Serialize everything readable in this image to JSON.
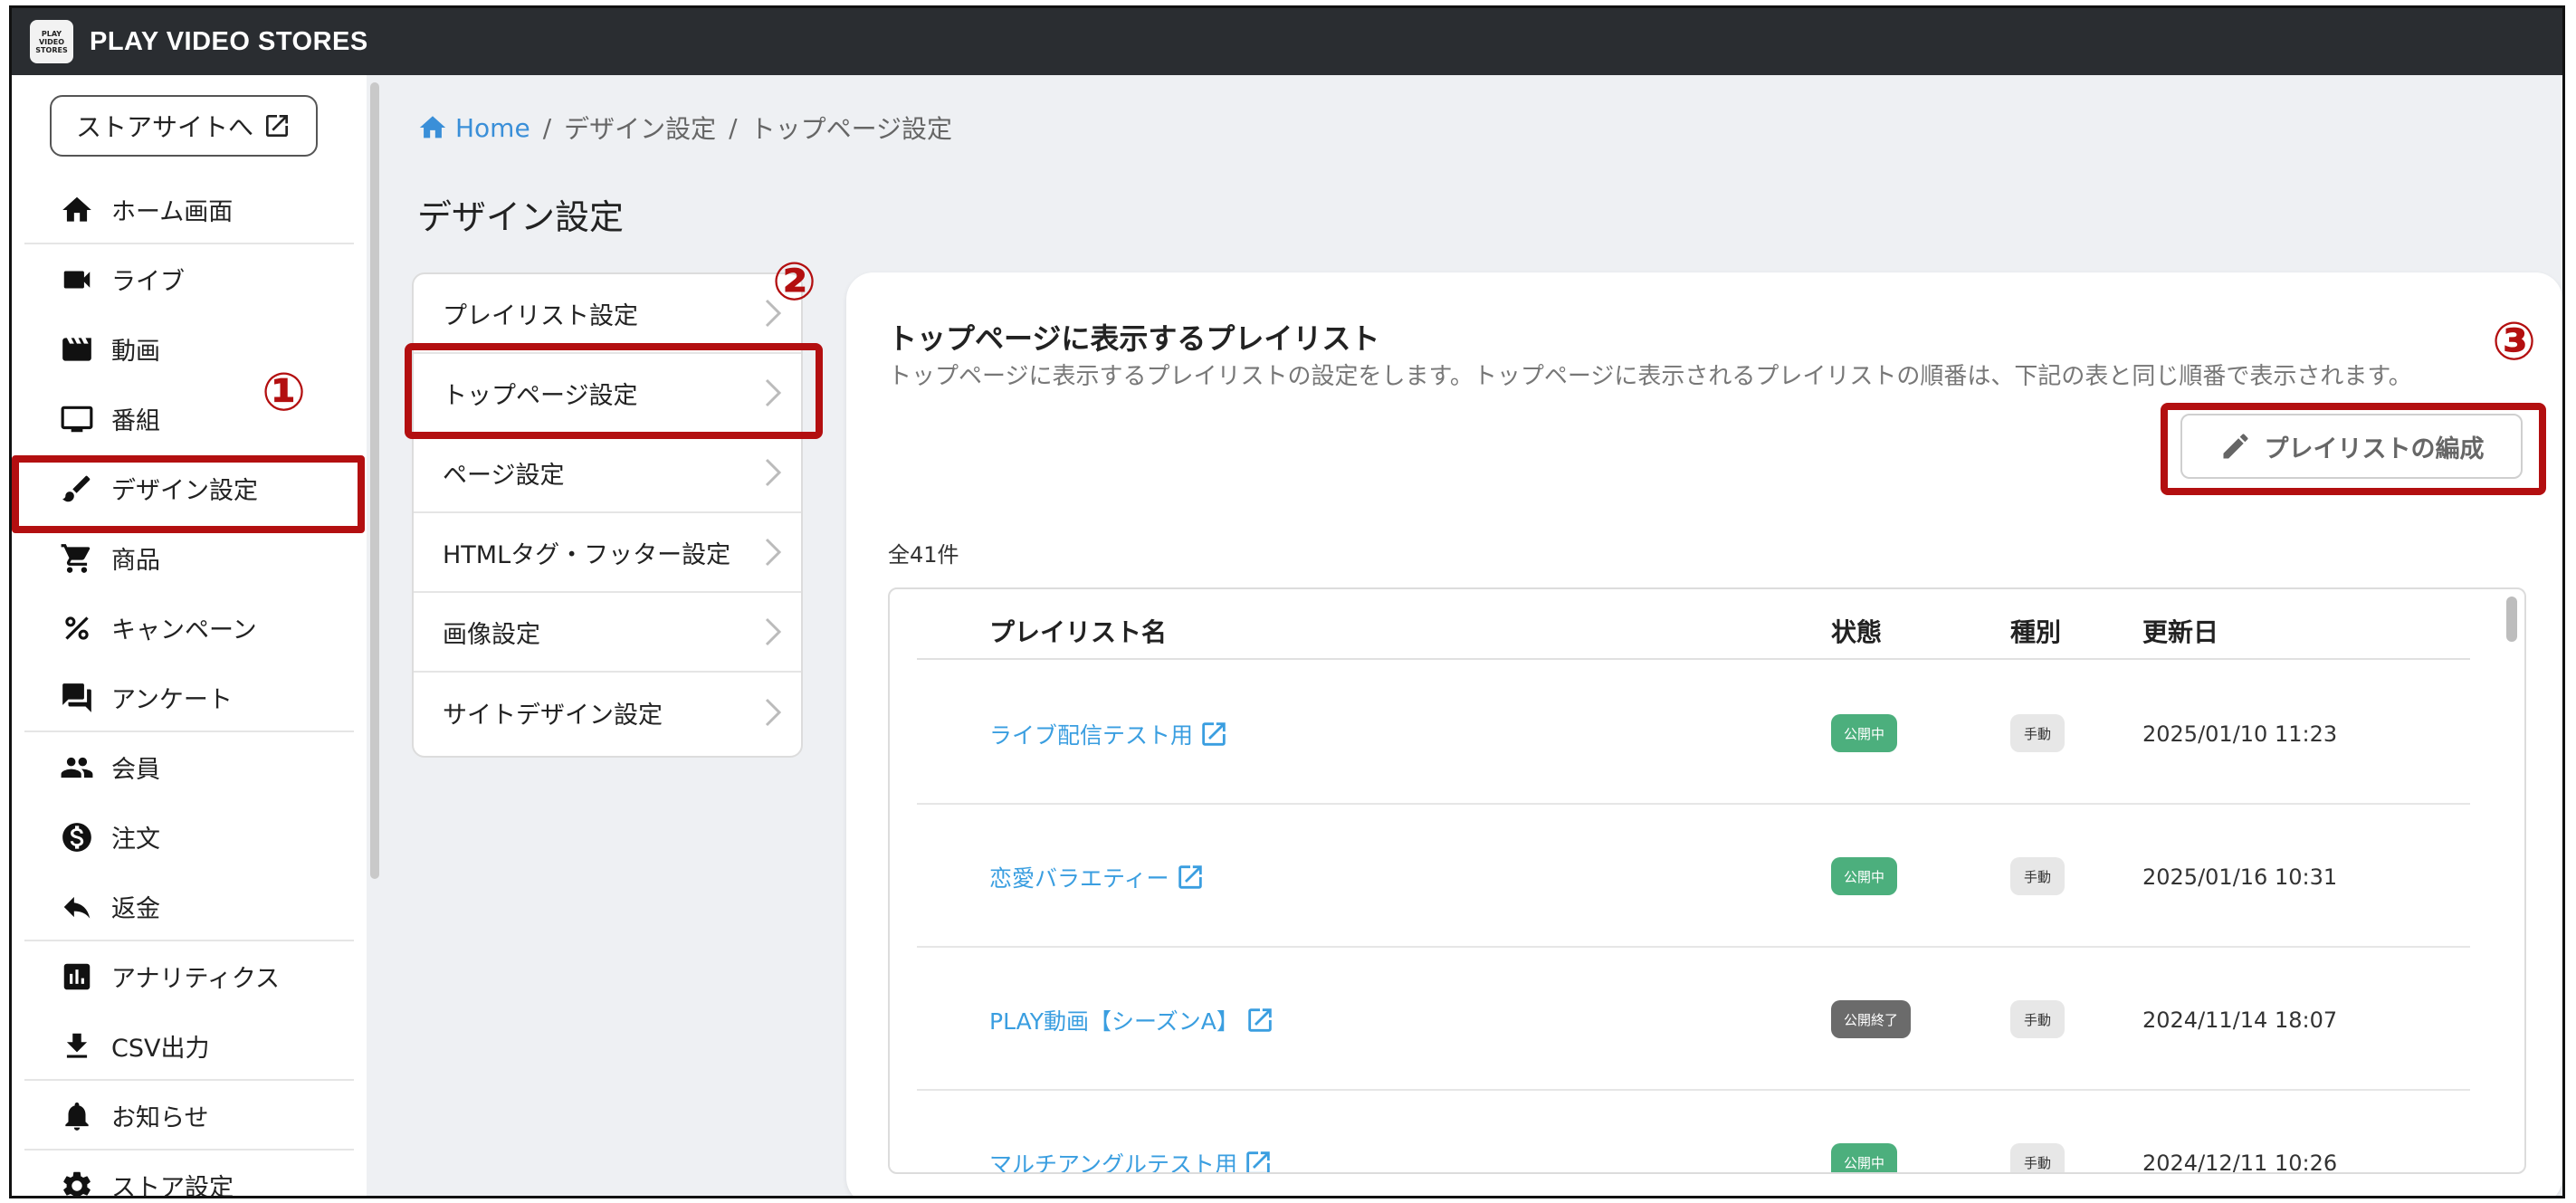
{
  "app": {
    "brand": "PLAY VIDEO STORES",
    "logo_text": [
      "PLAY",
      "VIDEO",
      "STORES"
    ]
  },
  "sidebar": {
    "store_button": "ストアサイトへ",
    "items": [
      {
        "label": "ホーム画面",
        "icon": "home-icon"
      },
      {
        "label": "ライブ",
        "icon": "videocam-icon"
      },
      {
        "label": "動画",
        "icon": "movie-icon"
      },
      {
        "label": "番組",
        "icon": "tv-icon"
      },
      {
        "label": "デザイン設定",
        "icon": "brush-icon"
      },
      {
        "label": "商品",
        "icon": "cart-icon"
      },
      {
        "label": "キャンペーン",
        "icon": "percent-icon"
      },
      {
        "label": "アンケート",
        "icon": "forum-icon"
      },
      {
        "label": "会員",
        "icon": "people-icon"
      },
      {
        "label": "注文",
        "icon": "dollar-icon"
      },
      {
        "label": "返金",
        "icon": "reply-icon"
      },
      {
        "label": "アナリティクス",
        "icon": "analytics-icon"
      },
      {
        "label": "CSV出力",
        "icon": "download-icon"
      },
      {
        "label": "お知らせ",
        "icon": "bell-icon"
      },
      {
        "label": "ストア設定",
        "icon": "gear-icon"
      }
    ]
  },
  "annotations": {
    "n1": "①",
    "n2": "②",
    "n3": "③"
  },
  "breadcrumb": {
    "home": "Home",
    "sep": "/",
    "level1": "デザイン設定",
    "level2": "トップページ設定"
  },
  "page_title": "デザイン設定",
  "submenu": [
    "プレイリスト設定",
    "トップページ設定",
    "ページ設定",
    "HTMLタグ・フッター設定",
    "画像設定",
    "サイトデザイン設定"
  ],
  "card": {
    "title": "トップページに表示するプレイリスト",
    "description": "トップページに表示するプレイリストの設定をします。トップページに表示されるプレイリストの順番は、下記の表と同じ順番で表示されます。",
    "edit_button": "プレイリストの編成",
    "total": "全41件"
  },
  "table": {
    "headers": {
      "name": "プレイリスト名",
      "status": "状態",
      "type": "種別",
      "updated": "更新日"
    },
    "rows": [
      {
        "name": "ライブ配信テスト用",
        "status": "公開中",
        "type": "手動",
        "updated": "2025/01/10 11:23"
      },
      {
        "name": "恋愛バラエティー",
        "status": "公開中",
        "type": "手動",
        "updated": "2025/01/16 10:31"
      },
      {
        "name": "PLAY動画【シーズンA】",
        "status": "公開終了",
        "type": "手動",
        "updated": "2024/11/14 18:07"
      },
      {
        "name": "マルチアングルテスト用",
        "status": "公開中",
        "type": "手動",
        "updated": "2024/12/11 10:26"
      }
    ]
  },
  "colors": {
    "accent": "#b30f10",
    "link": "#3a9ee0",
    "published": "#4caf7d",
    "ended": "#6b6b6b",
    "header": "#2a2d31"
  }
}
